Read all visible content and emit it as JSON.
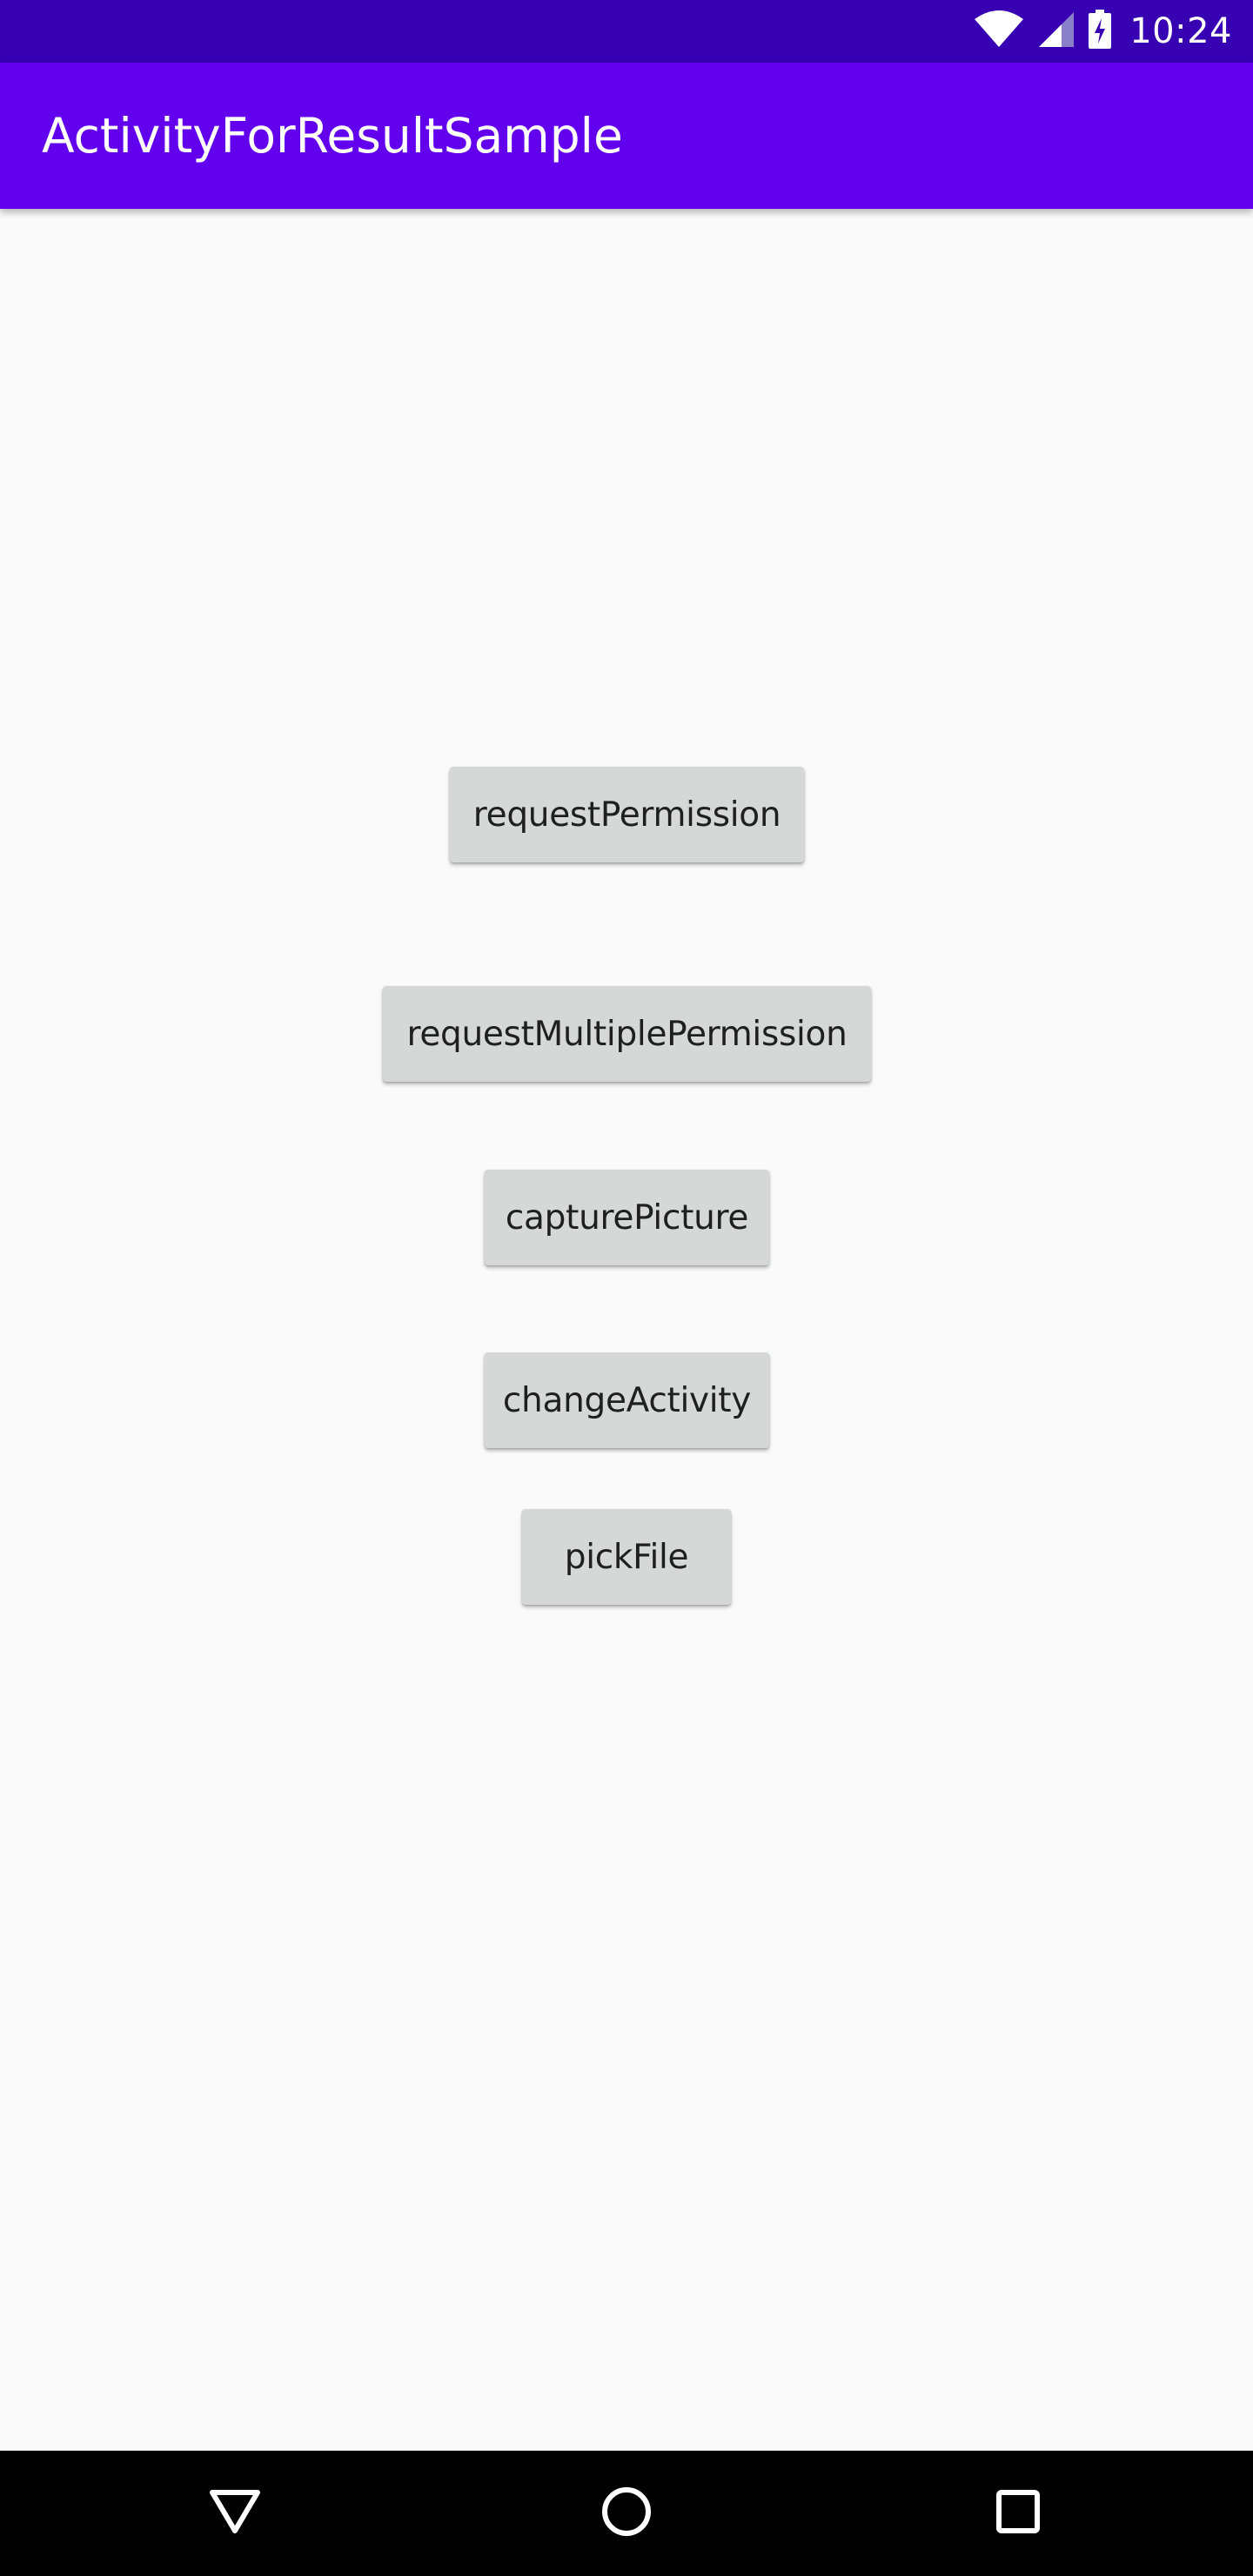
{
  "status_bar": {
    "time": "10:24",
    "icons": [
      "wifi-icon",
      "signal-icon",
      "battery-charging-icon"
    ],
    "background": "#3700b3"
  },
  "app_bar": {
    "title": "ActivityForResultSample",
    "background": "#6200ee"
  },
  "buttons": [
    {
      "label": "requestPermission"
    },
    {
      "label": "requestMultiplePermission"
    },
    {
      "label": "capturePicture"
    },
    {
      "label": "changeActivity"
    },
    {
      "label": "pickFile"
    }
  ],
  "nav_bar": {
    "icons": [
      "back-icon",
      "home-icon",
      "recents-icon"
    ]
  }
}
